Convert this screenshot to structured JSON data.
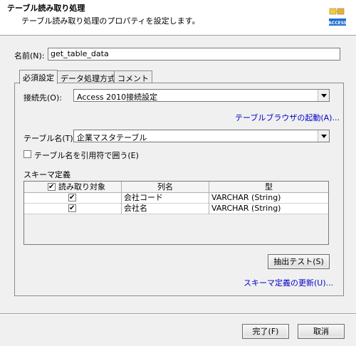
{
  "header": {
    "title": "テーブル読み取り処理",
    "description": "テーブル読み取り処理のプロパティを設定します。",
    "icon_badge": "ACCESS"
  },
  "name_field": {
    "label": "名前(N):",
    "value": "get_table_data"
  },
  "tabs": [
    {
      "label": "必須設定",
      "active": true
    },
    {
      "label": "データ処理方式",
      "active": false
    },
    {
      "label": "コメント",
      "active": false
    }
  ],
  "connection": {
    "label": "接続先(O):",
    "value": "Access 2010接続設定"
  },
  "browser_link": "テーブルブラウザの起動(A)...",
  "table_name": {
    "label": "テーブル名(T):",
    "value": "企業マスタテーブル"
  },
  "quote_option": {
    "label": "テーブル名を引用符で囲う(E)",
    "checked": false
  },
  "schema": {
    "section_label": "スキーマ定義",
    "columns": [
      "読み取り対象",
      "列名",
      "型"
    ],
    "header_checked": true,
    "rows": [
      {
        "checked": true,
        "name": "会社コード",
        "type": "VARCHAR (String)"
      },
      {
        "checked": true,
        "name": "会社名",
        "type": "VARCHAR (String)"
      }
    ]
  },
  "extract_test_button": "抽出テスト(S)",
  "schema_update_link": "スキーマ定義の更新(U)...",
  "footer": {
    "finish_button": "完了(F)",
    "cancel_button": "取消"
  },
  "colors": {
    "link": "#0000cc",
    "dialog_bg": "#f0f0f0",
    "header_bg": "#ffffff"
  }
}
